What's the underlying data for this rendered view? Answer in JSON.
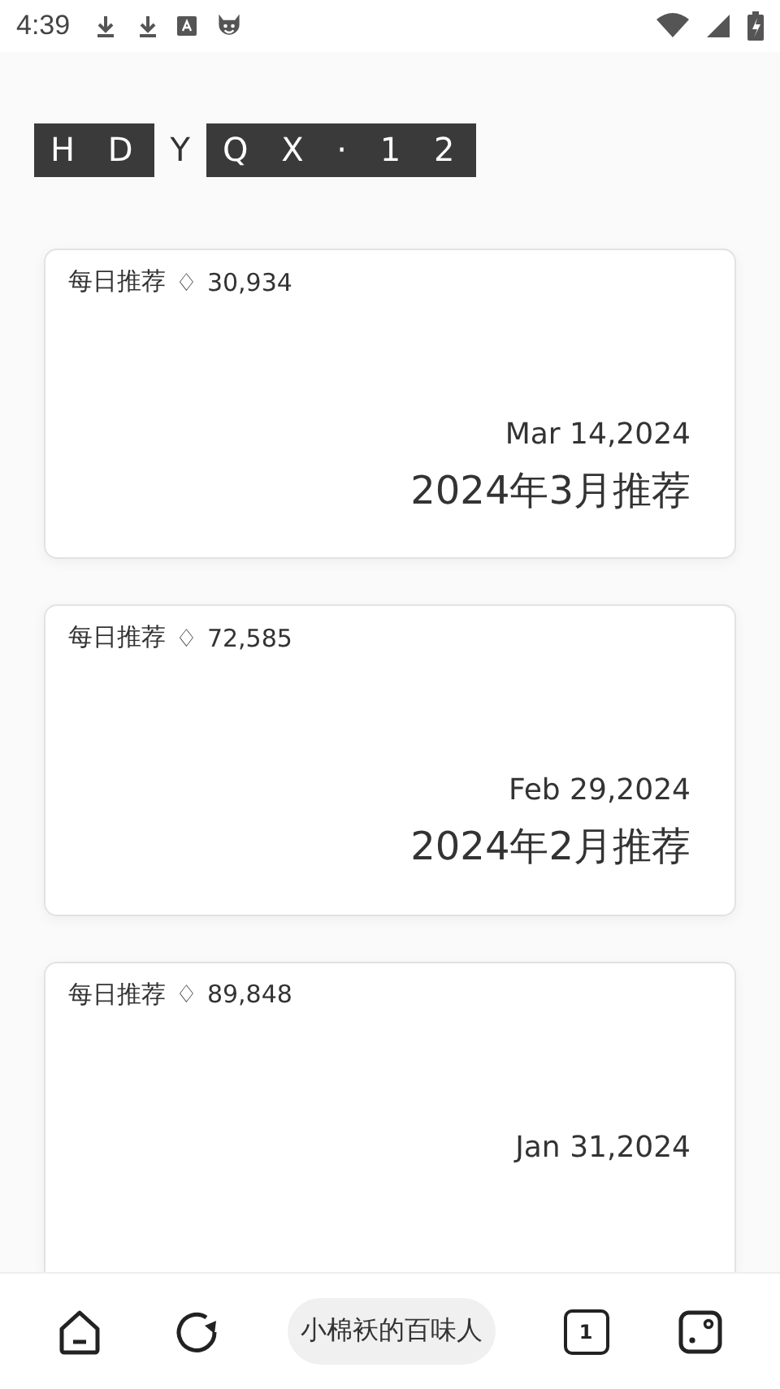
{
  "status_bar": {
    "time": "4:39"
  },
  "logo": [
    {
      "text": "H D",
      "kind": "boxed"
    },
    {
      "text": "Y",
      "kind": "plain"
    },
    {
      "text": "Q X · 1 2",
      "kind": "boxed"
    }
  ],
  "cards": [
    {
      "label": "每日推荐",
      "symbol": "♢",
      "count": "30,934",
      "date": "Mar 14,2024",
      "title": "2024年3月推荐"
    },
    {
      "label": "每日推荐",
      "symbol": "♢",
      "count": "72,585",
      "date": "Feb 29,2024",
      "title": "2024年2月推荐"
    },
    {
      "label": "每日推荐",
      "symbol": "♢",
      "count": "89,848",
      "date": "Jan 31,2024"
    }
  ],
  "bottom_nav": {
    "center_label": "小棉袄的百味人",
    "tab_count": "1"
  }
}
